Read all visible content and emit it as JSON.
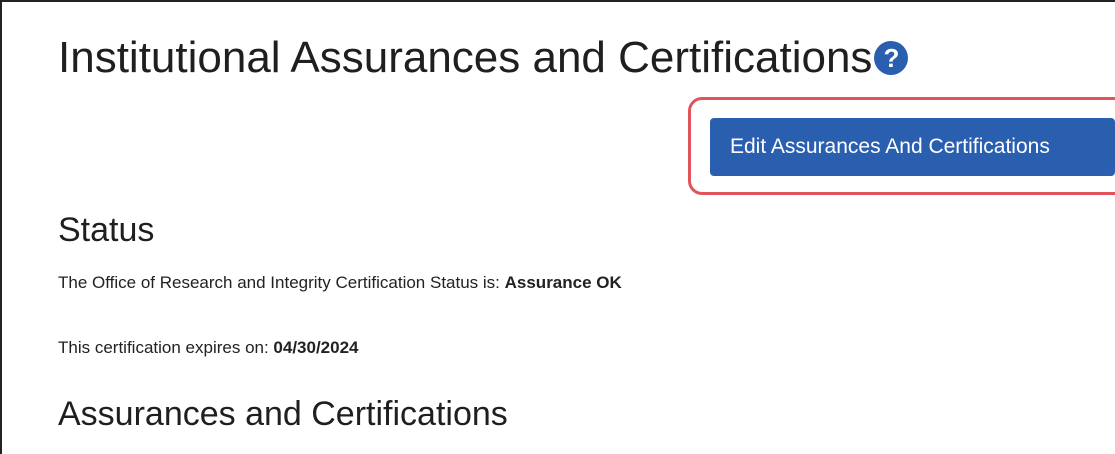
{
  "page": {
    "title": "Institutional Assurances and Certifications",
    "help_icon": "question-circle"
  },
  "actions": {
    "edit_label": "Edit Assurances And Certifications"
  },
  "status": {
    "heading": "Status",
    "certification_text": "The Office of Research and Integrity Certification Status is: ",
    "certification_value": "Assurance OK",
    "expires_text": "This certification expires on: ",
    "expires_value": "04/30/2024"
  },
  "assurances": {
    "heading": "Assurances and Certifications"
  },
  "colors": {
    "primary": "#2a5fb0",
    "highlight": "#e0545a"
  }
}
